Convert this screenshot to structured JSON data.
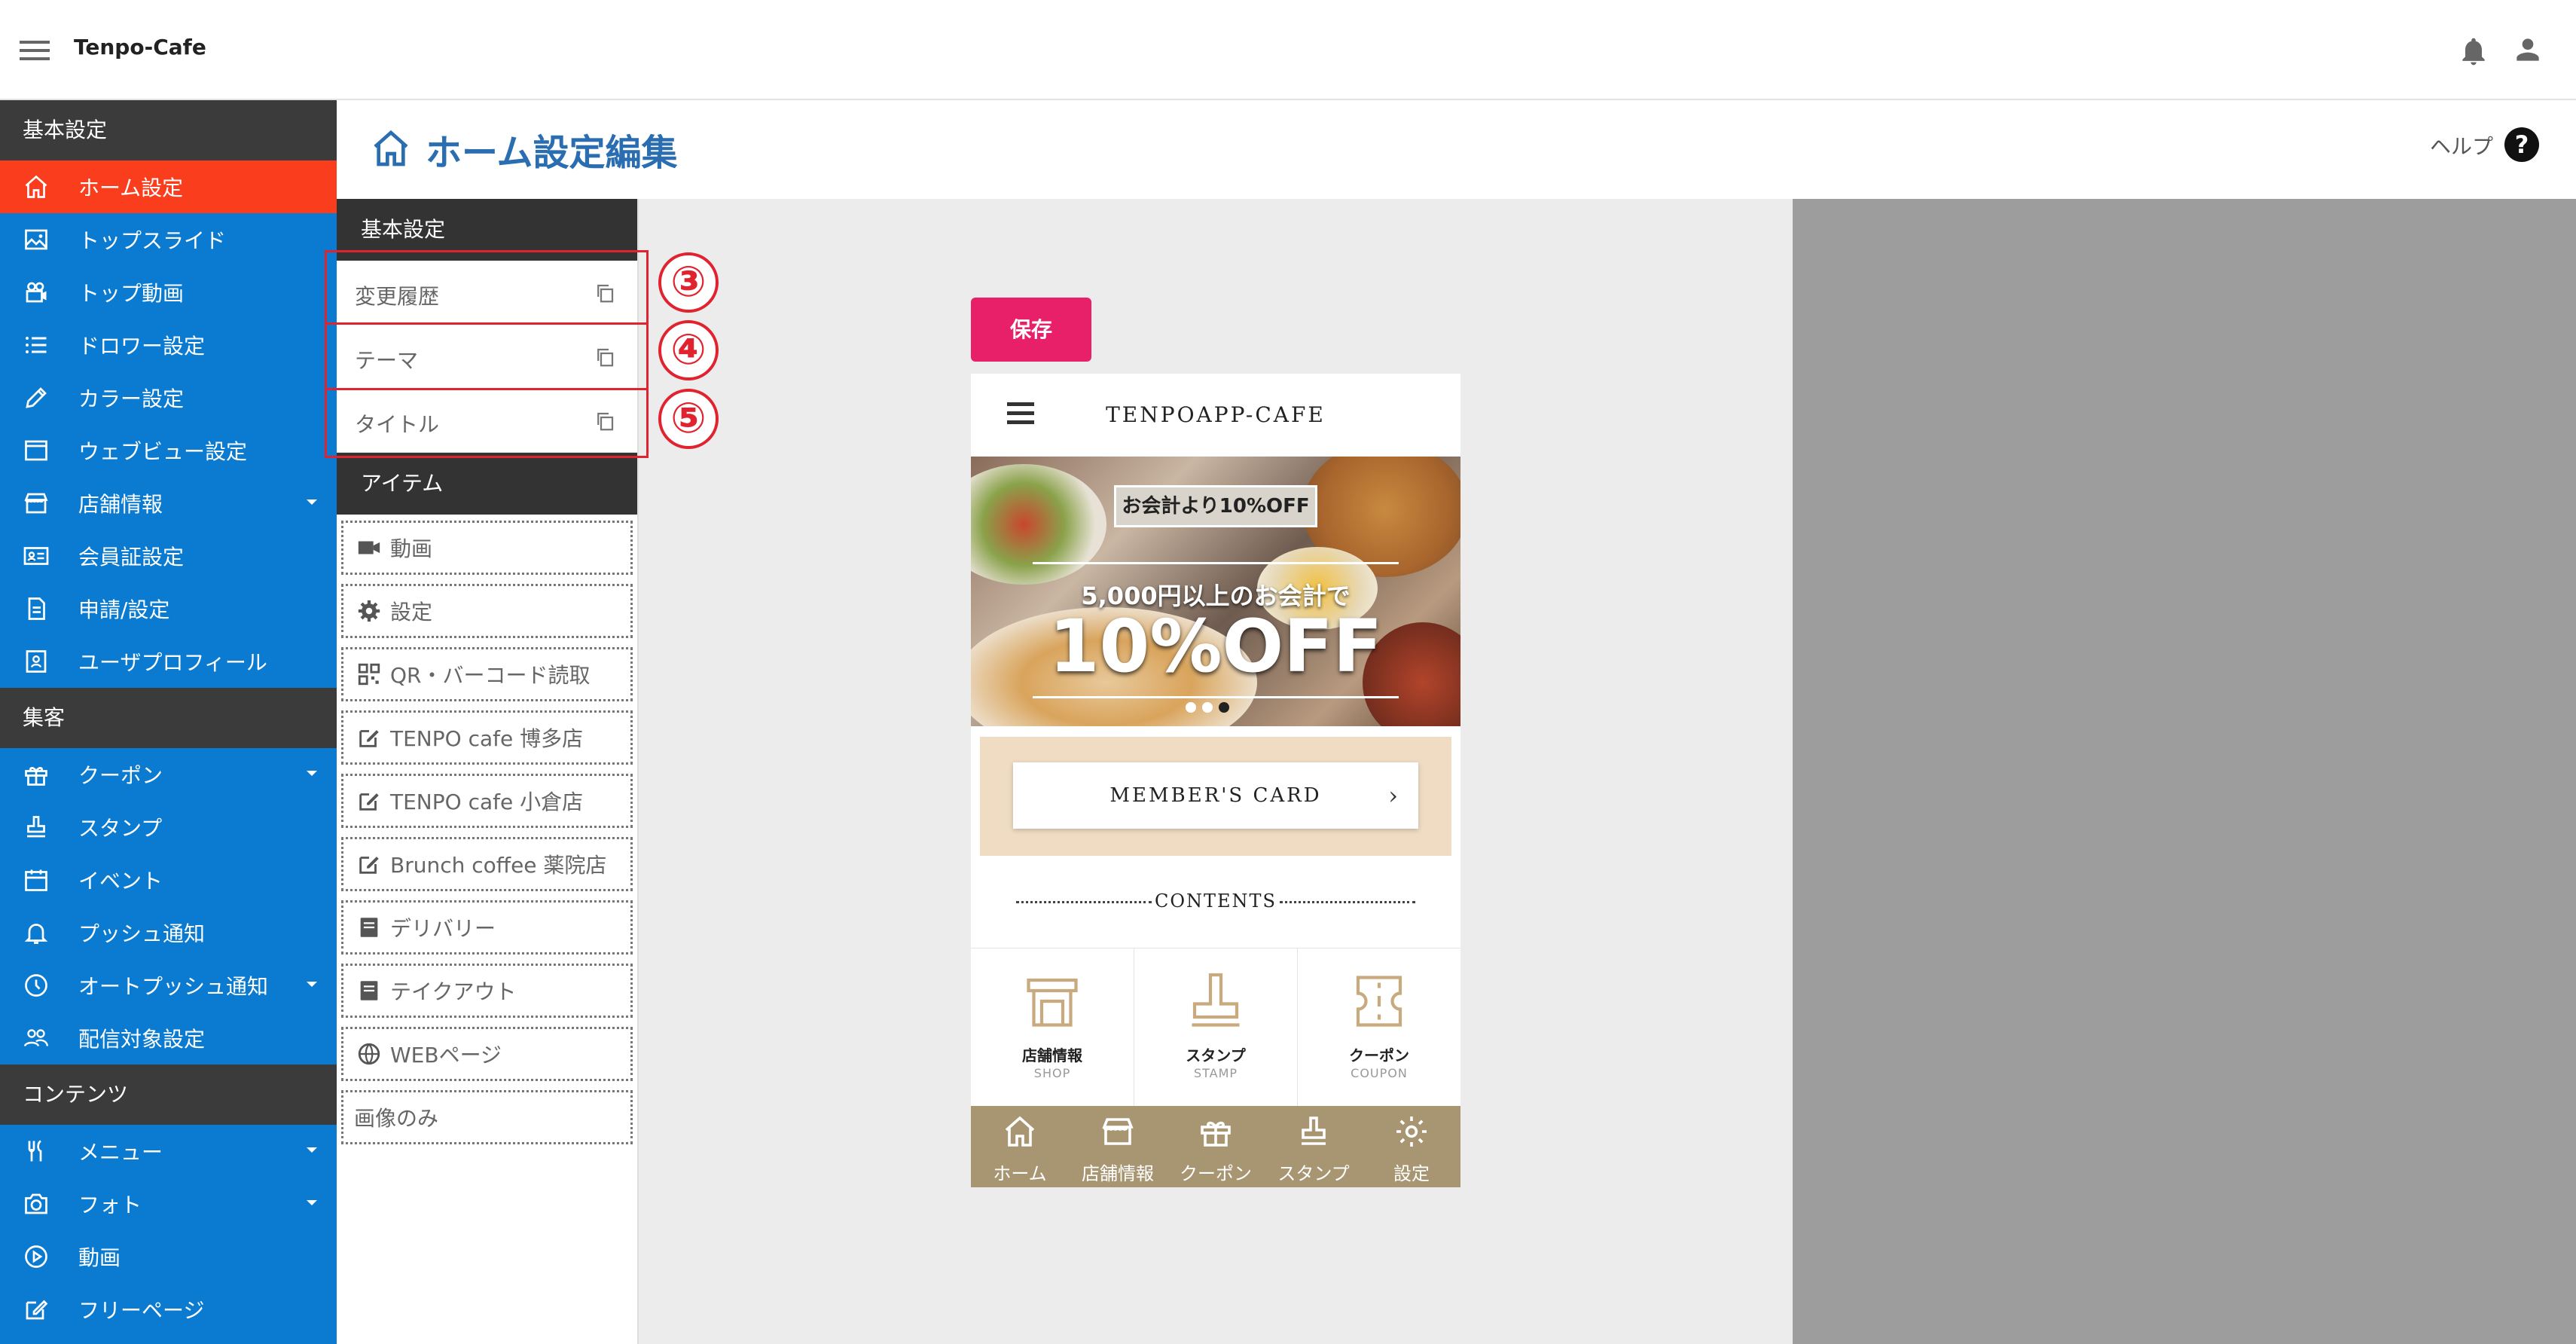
{
  "app": {
    "title": "Tenpo-Cafe"
  },
  "sidebar": {
    "sections": [
      {
        "label": "基本設定"
      },
      {
        "label": "集客"
      },
      {
        "label": "コンテンツ"
      }
    ],
    "items": [
      {
        "label": "ホーム設定",
        "icon": "home-icon",
        "active": true
      },
      {
        "label": "トップスライド",
        "icon": "image-icon"
      },
      {
        "label": "トップ動画",
        "icon": "video-camera-icon"
      },
      {
        "label": "ドロワー設定",
        "icon": "list-icon"
      },
      {
        "label": "カラー設定",
        "icon": "pencil-icon"
      },
      {
        "label": "ウェブビュー設定",
        "icon": "browser-icon"
      },
      {
        "label": "店舗情報",
        "icon": "store-icon",
        "expandable": true
      },
      {
        "label": "会員証設定",
        "icon": "id-card-icon"
      },
      {
        "label": "申請/設定",
        "icon": "document-icon"
      },
      {
        "label": "ユーザプロフィール",
        "icon": "profile-icon"
      },
      {
        "label": "クーポン",
        "icon": "gift-icon",
        "expandable": true
      },
      {
        "label": "スタンプ",
        "icon": "stamp-icon"
      },
      {
        "label": "イベント",
        "icon": "calendar-icon"
      },
      {
        "label": "プッシュ通知",
        "icon": "bell-icon"
      },
      {
        "label": "オートプッシュ通知",
        "icon": "clock-icon",
        "expandable": true
      },
      {
        "label": "配信対象設定",
        "icon": "group-icon"
      },
      {
        "label": "メニュー",
        "icon": "cutlery-icon",
        "expandable": true
      },
      {
        "label": "フォト",
        "icon": "camera-icon",
        "expandable": true
      },
      {
        "label": "動画",
        "icon": "play-icon"
      },
      {
        "label": "フリーページ",
        "icon": "edit-icon"
      }
    ]
  },
  "header": {
    "title": "ホーム設定編集",
    "help": "ヘルプ",
    "help_icon_glyph": "?"
  },
  "panel": {
    "basic_section": "基本設定",
    "basic_rows": [
      {
        "label": "変更履歴"
      },
      {
        "label": "テーマ"
      },
      {
        "label": "タイトル"
      }
    ],
    "callouts": [
      "③",
      "④",
      "⑤"
    ],
    "items_section": "アイテム",
    "items": [
      {
        "label": "動画",
        "icon": "video-icon"
      },
      {
        "label": "設定",
        "icon": "gear-icon"
      },
      {
        "label": "QR・バーコード読取",
        "icon": "qr-icon"
      },
      {
        "label": "TENPO cafe 博多店",
        "icon": "edit-icon"
      },
      {
        "label": "TENPO cafe 小倉店",
        "icon": "edit-icon"
      },
      {
        "label": "Brunch coffee 薬院店",
        "icon": "edit-icon"
      },
      {
        "label": "デリバリー",
        "icon": "book-icon"
      },
      {
        "label": "テイクアウト",
        "icon": "book-icon"
      },
      {
        "label": "WEBページ",
        "icon": "globe-icon"
      },
      {
        "label": "画像のみ",
        "icon": ""
      }
    ]
  },
  "preview": {
    "save_label": "保存",
    "brand": "TENPOAPP-CAFE",
    "banner": {
      "badge": "お会計より10%OFF",
      "sub": "5,000円以上のお会計で",
      "main": "10%OFF",
      "slide_count": 3,
      "active_slide": 3
    },
    "card_label": "MEMBER'S CARD",
    "card_chevron": "›",
    "contents_label": "CONTENTS",
    "tiles": [
      {
        "jp": "店舗情報",
        "en": "SHOP",
        "icon": "shop-icon"
      },
      {
        "jp": "スタンプ",
        "en": "STAMP",
        "icon": "stamp-icon"
      },
      {
        "jp": "クーポン",
        "en": "COUPON",
        "icon": "ticket-icon"
      }
    ],
    "tabs": [
      {
        "label": "ホーム",
        "icon": "home-icon"
      },
      {
        "label": "店舗情報",
        "icon": "store-icon"
      },
      {
        "label": "クーポン",
        "icon": "gift-icon"
      },
      {
        "label": "スタンプ",
        "icon": "stamp-icon"
      },
      {
        "label": "設定",
        "icon": "gear-icon"
      }
    ]
  },
  "colors": {
    "sidebar_bg": "#0a7bd0",
    "active_item": "#fa3d1d",
    "section_bg": "#3b3b3b",
    "title_blue": "#2a6db0",
    "save_pink": "#e8206a",
    "callout_red": "#e0232e",
    "tabbar_brown": "#a89673",
    "card_beige": "#efdcc3"
  }
}
